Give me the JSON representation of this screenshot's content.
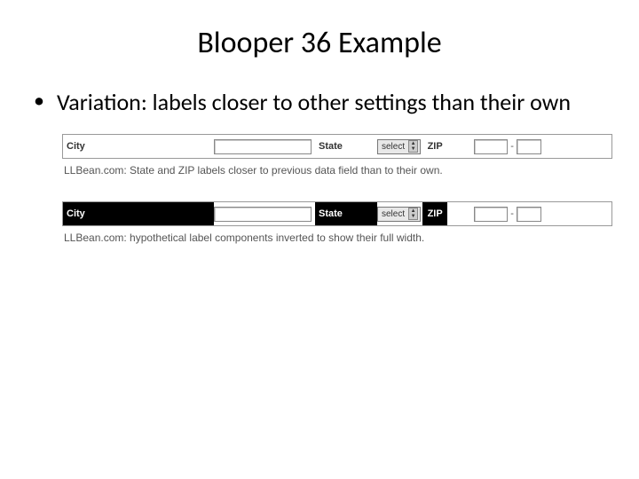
{
  "title": "Blooper 36 Example",
  "bullet": "Variation: labels closer to other settings than their own",
  "form": {
    "city_label": "City",
    "state_label": "State",
    "select_text": "select",
    "zip_label": "ZIP",
    "dash": "-"
  },
  "caption1": "LLBean.com: State and ZIP labels closer to previous data field than to their own.",
  "caption2": "LLBean.com: hypothetical label components inverted to show their full width."
}
